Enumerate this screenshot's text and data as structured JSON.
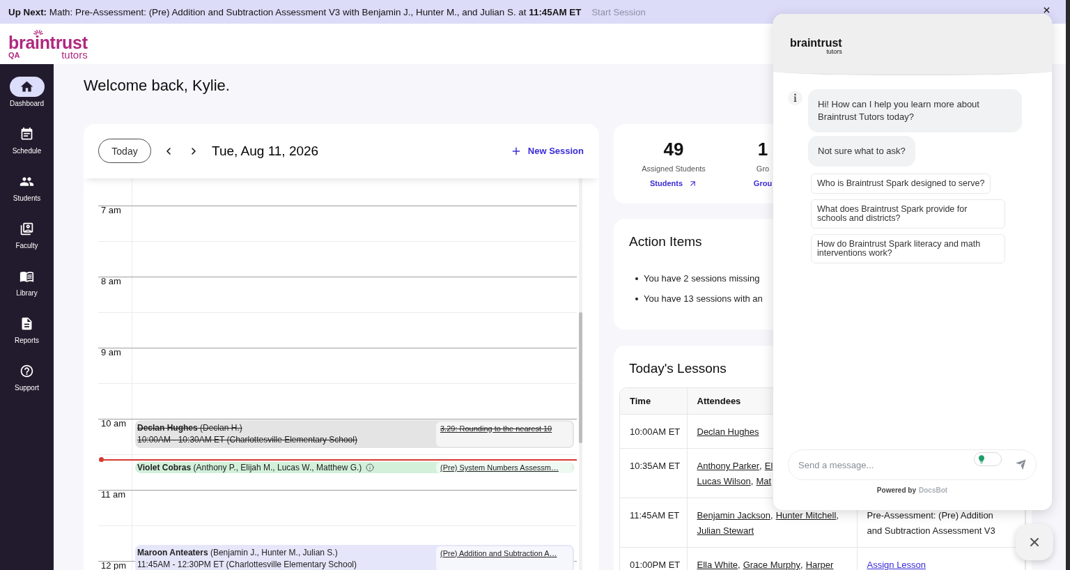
{
  "banner": {
    "text": "**Up Next:** Math: Pre-Assessment: (Pre) Addition and Subtraction Assessment V3 with Benjamin J., Hunter M., and Julian S. at **11:45AM ET**",
    "action": {
      "label": "Start Session",
      "disabled": true
    }
  },
  "header": {
    "logo": {
      "wordmark": "braintrust",
      "tagline": "tutors",
      "environment": "QA"
    }
  },
  "sidebar": {
    "items": [
      {
        "label": "Dashboard",
        "selected": true
      },
      {
        "label": "Schedule",
        "selected": false
      },
      {
        "label": "Students",
        "selected": false
      },
      {
        "label": "Faculty",
        "selected": false
      },
      {
        "label": "Library",
        "selected": false
      },
      {
        "label": "Reports",
        "selected": false
      },
      {
        "label": "Support",
        "selected": false
      }
    ]
  },
  "greeting": "Welcome back, Kylie.",
  "calendar": {
    "today_button": "Today",
    "date": "Tue, Aug 11, 2026",
    "new_session": "New Session",
    "hours": [
      {
        "label": "7 am"
      },
      {
        "label": "8 am"
      },
      {
        "label": "9 am"
      },
      {
        "label": "10 am",
        "events": [
          {
            "title": "**Declan Hughes** (Declan H.)",
            "details": "10:00AM - 10:30AM ET (Charlottesville Elementary School)",
            "lesson": "3.29: Rounding to the nearest 10",
            "cancelled": true,
            "in_progress": false,
            "info": false,
            "color": "#e4e4e4"
          },
          {
            "title": "**Violet Cobras** (Anthony P., Elijah M., Lucas W., Matthew G.)",
            "lesson": "(Pre) System Numbers Assessm…",
            "cancelled": false,
            "in_progress": true,
            "info": true,
            "color": "#d2f0da"
          }
        ]
      },
      {
        "label": "11 am",
        "events": [
          {
            "title": "**Maroon Anteaters** (Benjamin J., Hunter M., Julian S.)",
            "details": "11:45AM - 12:30PM ET (Charlottesville Elementary School)",
            "lesson": "(Pre) Addition and Subtraction A…",
            "cancelled": false,
            "in_progress": false,
            "info": false,
            "color": "#e6e6fa"
          }
        ]
      },
      {
        "label": "12 pm"
      }
    ]
  },
  "stats": [
    {
      "value": "49",
      "label": "Assigned Students",
      "link": "Students",
      "arrow": true
    },
    {
      "value": "1",
      "label": "Gro",
      "link": "Grou",
      "arrow": false
    }
  ],
  "action_items": {
    "title": "Action Items",
    "items": [
      "You have 2 sessions missing",
      "You have 13 sessions with an"
    ]
  },
  "todays_lessons": {
    "title": "Today's Lessons",
    "columns": [
      "Time",
      "Attendees"
    ],
    "rows": [
      {
        "time": "10:00AM ET",
        "attendees": [
          [
            {
              "name": "Declan Hughes"
            }
          ]
        ]
      },
      {
        "time": "10:35AM ET",
        "attendees": [
          [
            {
              "name": "Anthony Parker",
              "sep": ","
            },
            {
              "name": "El"
            }
          ],
          [
            {
              "name": "Lucas Wilson",
              "sep": ","
            },
            {
              "name": "Mat"
            }
          ]
        ]
      },
      {
        "time": "11:45AM ET",
        "attendees": [
          [
            {
              "name": "Benjamin Jackson",
              "sep": ","
            },
            {
              "name": "Hunter Mitchell",
              "sep": ","
            }
          ],
          [
            {
              "name": "Julian Stewart"
            }
          ]
        ],
        "lesson": {
          "kind": "text",
          "text": "Pre-Assessment: (Pre) Addition and Subtraction Assessment V3"
        }
      },
      {
        "time": "01:00PM ET",
        "attendees": [
          [
            {
              "name": "Ella White",
              "sep": ","
            },
            {
              "name": "Grace Murphy",
              "sep": ","
            },
            {
              "name": "Harper"
            }
          ]
        ],
        "lesson": {
          "kind": "link",
          "text": "Assign Lesson"
        }
      }
    ]
  },
  "chat": {
    "logo": {
      "wordmark": "braintrust",
      "tagline": "tutors"
    },
    "messages": [
      {
        "text": "Hi! How can I help you learn more about Braintrust Tutors today?",
        "avatar": true
      },
      {
        "text": "Not sure what to ask?",
        "avatar": false
      }
    ],
    "suggestions": [
      "Who is Braintrust Spark designed to serve?",
      "What does Braintrust Spark provide for schools and districts?",
      "How do Braintrust Spark literacy and math interventions work?"
    ],
    "input": {
      "placeholder": "Send a message...",
      "toggle": {
        "on": false
      }
    },
    "footer": {
      "label": "Powered by",
      "brand": "DocsBot"
    }
  }
}
